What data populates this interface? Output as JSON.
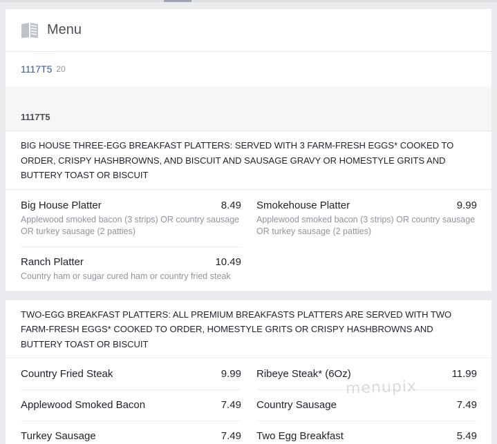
{
  "header": {
    "title": "Menu",
    "icon": "book-icon"
  },
  "menu_link": {
    "label": "1117T5",
    "count": "20"
  },
  "menu_name": "1117T5",
  "sections": [
    {
      "description": "BIG HOUSE THREE-EGG BREAKFAST PLATTERS: SERVED WITH 3 FARM-FRESH EGGS* COOKED TO ORDER, CRISPY HASHBROWNS, AND BISCUIT AND SAUSAGE GRAVY OR HOMESTYLE GRITS AND BUTTERY TOAST OR BISCUIT",
      "items": [
        {
          "name": "Big House Platter",
          "price": "8.49",
          "desc": "Applewood smoked bacon (3 strips) OR country sausage OR turkey sausage (2 patties)"
        },
        {
          "name": "Smokehouse Platter",
          "price": "9.99",
          "desc": "Applewood smoked bacon (3 strips) OR country sausage OR turkey sausage (2 patties)"
        },
        {
          "name": "Ranch Platter",
          "price": "10.49",
          "desc": "Country ham or sugar cured ham or country fried steak"
        }
      ]
    },
    {
      "description": "TWO-EGG BREAKFAST PLATTERS: ALL PREMIUM BREAKFASTS PLATTERS ARE SERVED WITH TWO FARM-FRESH EGGS* COOKED TO ORDER, HOMESTYLE GRITS OR CRISPY HASHBROWNS AND BUTTERY TOAST OR BISCUIT",
      "items": [
        {
          "name": "Country Fried Steak",
          "price": "9.99"
        },
        {
          "name": "Ribeye Steak* (6Oz)",
          "price": "11.99"
        },
        {
          "name": "Applewood Smoked Bacon",
          "price": "7.49"
        },
        {
          "name": "Country Sausage",
          "price": "7.49"
        },
        {
          "name": "Turkey Sausage",
          "price": "7.49"
        },
        {
          "name": "Two Egg Breakfast",
          "price": "5.49"
        }
      ]
    }
  ],
  "watermark": "menupix"
}
